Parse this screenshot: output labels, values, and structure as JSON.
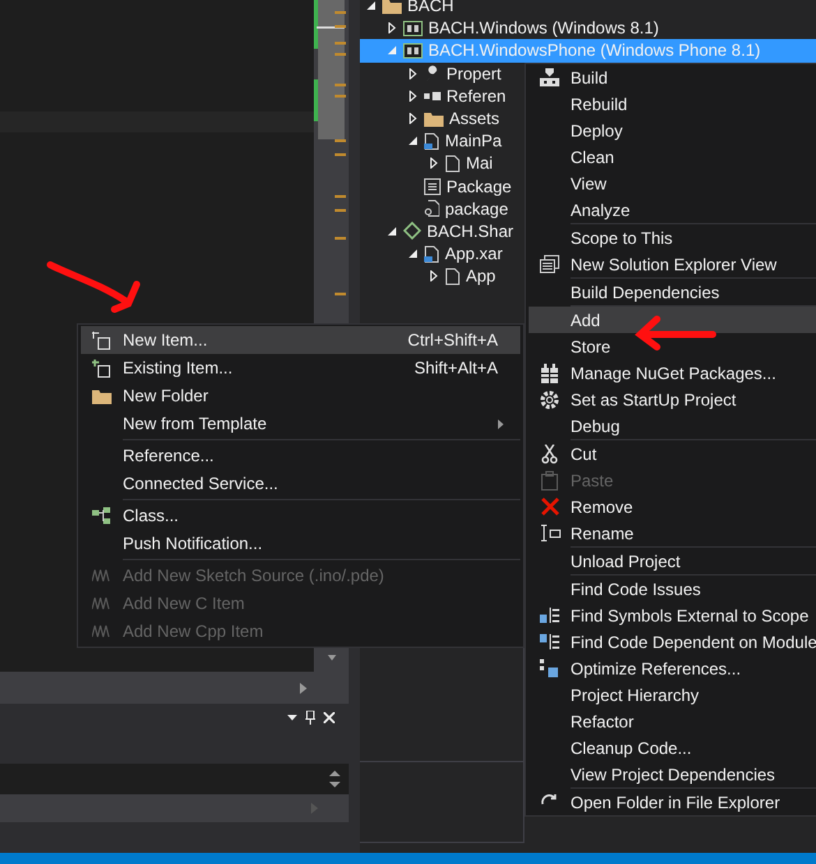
{
  "solution_explorer": {
    "tree": [
      {
        "label": "BACH",
        "expanded": true,
        "selected": false,
        "children": [
          {
            "label": "BACH.Windows (Windows 8.1)",
            "expanded": false,
            "selected": false
          },
          {
            "label": "BACH.WindowsPhone (Windows Phone 8.1)",
            "expanded": true,
            "selected": true,
            "children": [
              {
                "label": "Propert",
                "expanded": false,
                "selected": false
              },
              {
                "label": "Referen",
                "expanded": false,
                "selected": false
              },
              {
                "label": "Assets",
                "expanded": false,
                "selected": false
              },
              {
                "label": "MainPa",
                "expanded": true,
                "selected": false,
                "children": [
                  {
                    "label": "Mai",
                    "expanded": false,
                    "selected": false
                  }
                ]
              },
              {
                "label": "Package",
                "selected": false
              },
              {
                "label": "package",
                "selected": false
              }
            ]
          },
          {
            "label": "BACH.Shar",
            "expanded": true,
            "selected": false,
            "children": [
              {
                "label": "App.xar",
                "expanded": true,
                "selected": false,
                "children": [
                  {
                    "label": "App",
                    "expanded": false,
                    "selected": false
                  }
                ]
              }
            ]
          }
        ]
      }
    ]
  },
  "context_menu": {
    "items": [
      {
        "kind": "item",
        "label": "Build",
        "selected": false,
        "disabled": false
      },
      {
        "kind": "item",
        "label": "Rebuild",
        "selected": false,
        "disabled": false
      },
      {
        "kind": "item",
        "label": "Deploy",
        "selected": false,
        "disabled": false
      },
      {
        "kind": "item",
        "label": "Clean",
        "selected": false,
        "disabled": false
      },
      {
        "kind": "item",
        "label": "View",
        "selected": false,
        "disabled": false
      },
      {
        "kind": "item",
        "label": "Analyze",
        "selected": false,
        "disabled": false
      },
      {
        "kind": "separator"
      },
      {
        "kind": "item",
        "label": "Scope to This",
        "selected": false,
        "disabled": false
      },
      {
        "kind": "item",
        "label": "New Solution Explorer View",
        "selected": false,
        "disabled": false
      },
      {
        "kind": "separator"
      },
      {
        "kind": "item",
        "label": "Build Dependencies",
        "selected": false,
        "disabled": false
      },
      {
        "kind": "separator"
      },
      {
        "kind": "item",
        "label": "Add",
        "selected": true,
        "disabled": false
      },
      {
        "kind": "item",
        "label": "Store",
        "selected": false,
        "disabled": false
      },
      {
        "kind": "item",
        "label": "Manage NuGet Packages...",
        "selected": false,
        "disabled": false
      },
      {
        "kind": "item",
        "label": "Set as StartUp Project",
        "selected": false,
        "disabled": false
      },
      {
        "kind": "item",
        "label": "Debug",
        "selected": false,
        "disabled": false
      },
      {
        "kind": "separator"
      },
      {
        "kind": "item",
        "label": "Cut",
        "selected": false,
        "disabled": false
      },
      {
        "kind": "item",
        "label": "Paste",
        "selected": false,
        "disabled": true
      },
      {
        "kind": "item",
        "label": "Remove",
        "selected": false,
        "disabled": false
      },
      {
        "kind": "item",
        "label": "Rename",
        "selected": false,
        "disabled": false
      },
      {
        "kind": "separator"
      },
      {
        "kind": "item",
        "label": "Unload Project",
        "selected": false,
        "disabled": false
      },
      {
        "kind": "separator"
      },
      {
        "kind": "item",
        "label": "Find Code Issues",
        "selected": false,
        "disabled": false
      },
      {
        "kind": "item",
        "label": "Find Symbols External to Scope",
        "selected": false,
        "disabled": false
      },
      {
        "kind": "item",
        "label": "Find Code Dependent on Module",
        "selected": false,
        "disabled": false
      },
      {
        "kind": "item",
        "label": "Optimize References...",
        "selected": false,
        "disabled": false
      },
      {
        "kind": "item",
        "label": "Project Hierarchy",
        "selected": false,
        "disabled": false
      },
      {
        "kind": "item",
        "label": "Refactor",
        "selected": false,
        "disabled": false
      },
      {
        "kind": "item",
        "label": "Cleanup Code...",
        "selected": false,
        "disabled": false
      },
      {
        "kind": "item",
        "label": "View Project Dependencies",
        "selected": false,
        "disabled": false
      },
      {
        "kind": "separator"
      },
      {
        "kind": "item",
        "label": "Open Folder in File Explorer",
        "selected": false,
        "disabled": false
      }
    ]
  },
  "add_submenu": {
    "items": [
      {
        "kind": "item",
        "label": "New Item...",
        "shortcut": "Ctrl+Shift+A",
        "selected": true,
        "disabled": false
      },
      {
        "kind": "item",
        "label": "Existing Item...",
        "shortcut": "Shift+Alt+A",
        "selected": false,
        "disabled": false
      },
      {
        "kind": "item",
        "label": "New Folder",
        "selected": false,
        "disabled": false
      },
      {
        "kind": "item",
        "label": "New from Template",
        "submenu": true,
        "selected": false,
        "disabled": false
      },
      {
        "kind": "separator"
      },
      {
        "kind": "item",
        "label": "Reference...",
        "selected": false,
        "disabled": false
      },
      {
        "kind": "item",
        "label": "Connected Service...",
        "selected": false,
        "disabled": false
      },
      {
        "kind": "separator"
      },
      {
        "kind": "item",
        "label": "Class...",
        "selected": false,
        "disabled": false
      },
      {
        "kind": "item",
        "label": "Push Notification...",
        "selected": false,
        "disabled": false
      },
      {
        "kind": "separator"
      },
      {
        "kind": "item",
        "label": "Add New Sketch Source (.ino/.pde)",
        "selected": false,
        "disabled": true
      },
      {
        "kind": "item",
        "label": "Add New C Item",
        "selected": false,
        "disabled": true
      },
      {
        "kind": "item",
        "label": "Add New Cpp Item",
        "selected": false,
        "disabled": true
      }
    ]
  }
}
